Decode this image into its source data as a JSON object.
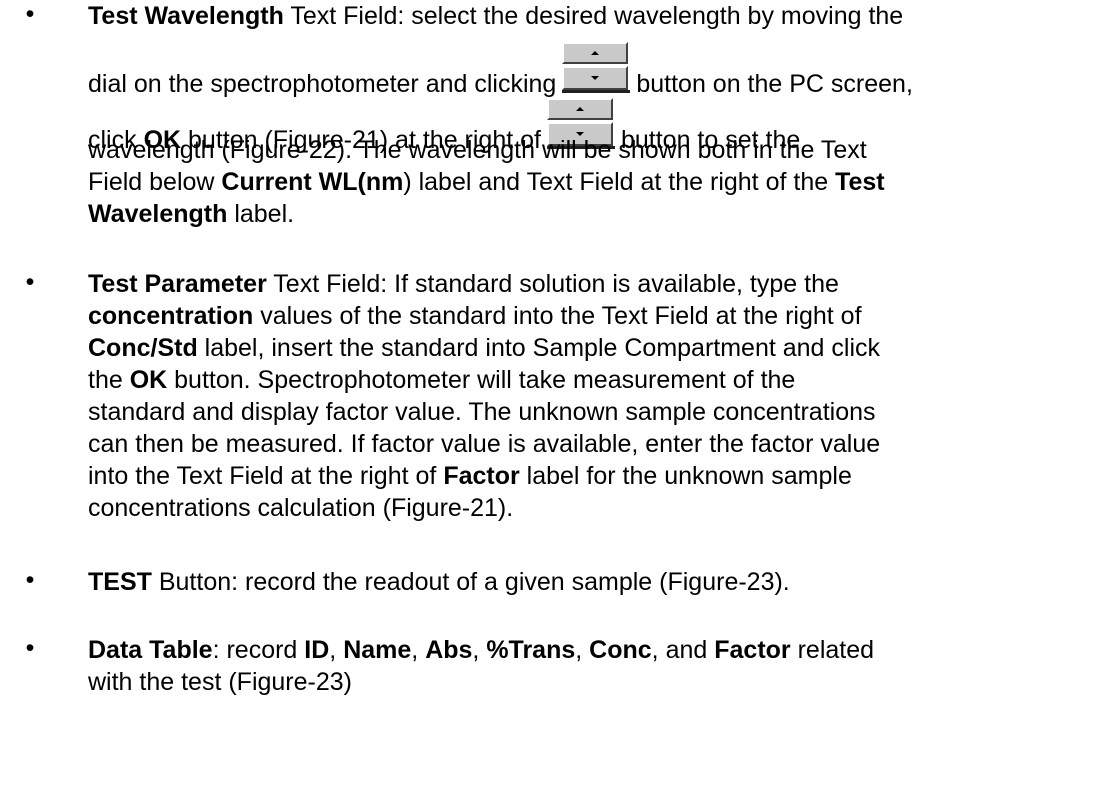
{
  "bullet_glyph": "•",
  "items": [
    {
      "lines": [
        {
          "bold": "Test Wavelength",
          "text": " Text Field: select the desired wavelength by moving the"
        },
        {
          "pre": "dial on the spectrophotometer and clicking",
          "post": "button on the PC screen,"
        },
        {
          "pre_a": "click ",
          "bold": "OK",
          "pre_b": " button (Figure-21) at the right of",
          "post": "button to set the"
        },
        {
          "text": "wavelength (Figure-22).  The wavelength will be shown both in the Text"
        },
        {
          "text": "Field below ",
          "bold": "Current WL(nm",
          "text2": ") label and Text Field at the right of the ",
          "bold2": "Test"
        },
        {
          "bold": "Wavelength",
          "text": " label."
        }
      ]
    },
    {
      "lines": [
        {
          "bold": "Test Parameter",
          "text": " Text Field: If standard solution is available, type the"
        },
        {
          "bold": "concentration",
          "text": " values of the standard into the Text Field at the right of"
        },
        {
          "bold": "Conc/Std",
          "text": " label, insert the standard into Sample Compartment and click"
        },
        {
          "text": "the ",
          "bold": "OK",
          "text2": " button.   Spectrophotometer will take measurement of the"
        },
        {
          "text": "standard and display factor value.  The unknown sample concentrations"
        },
        {
          "text": "can then be measured.  If factor value is available, enter the factor value"
        },
        {
          "text": "into the Text Field at the right of ",
          "bold": "Factor",
          "text2": " label for the unknown sample"
        },
        {
          "text": "concentrations calculation (Figure-21)."
        }
      ]
    },
    {
      "lines": [
        {
          "bold": "TEST",
          "text": " Button: record the readout of a given sample (Figure-23)."
        }
      ]
    },
    {
      "lines": [
        {
          "bold": "Data Table",
          "text": ": record ",
          "bold2": "ID",
          "t2": ", ",
          "bold3": "Name",
          "t3": ", ",
          "bold4": "Abs",
          "t4": ", ",
          "bold5": "%Trans",
          "t5": ", ",
          "bold6": "Conc",
          "t6": ", and ",
          "bold7": "Factor",
          "t7": " related"
        },
        {
          "text": "with the test (Figure-23)"
        }
      ]
    }
  ]
}
